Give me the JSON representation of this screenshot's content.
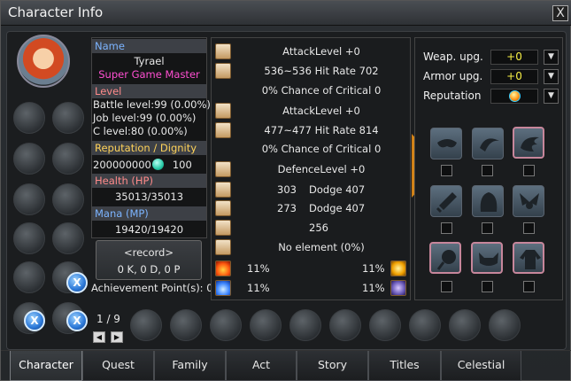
{
  "window": {
    "title": "Character Info",
    "close_label": "X"
  },
  "character": {
    "name_label": "Name",
    "name": "Tyrael",
    "rank": "Super Game Master",
    "level_label": "Level",
    "battle_level": "Battle level:99 (0.00%)",
    "job_level": "Job level:99 (0.00%)",
    "c_level": "C level:80 (0.00%)",
    "rep_label": "Reputation / Dignity",
    "reputation": "200000000",
    "dignity": "100",
    "hp_label": "Health (HP)",
    "hp": "35013/35013",
    "mp_label": "Mana (MP)",
    "mp": "19420/19420"
  },
  "record": {
    "title": "<record>",
    "kda": "0 K, 0 D, 0 P",
    "achievement": "Achievement Point(s): 0"
  },
  "stats": {
    "attack1_level": "AttackLevel +0",
    "attack1_hit": "536~536 Hit Rate 702",
    "attack1_crit": "0% Chance of Critical  0",
    "attack2_level": "AttackLevel +0",
    "attack2_hit": "477~477 Hit Rate 814",
    "attack2_crit": "0% Chance of Critical  0",
    "defence_level": "DefenceLevel +0",
    "def1_value": "303",
    "def1_dodge": "Dodge 407",
    "def2_value": "273",
    "def2_dodge": "Dodge 407",
    "def3_value": "256",
    "element": "No element (0%)",
    "fire": "11%",
    "light": "11%",
    "water": "11%",
    "dark": "11%"
  },
  "upgrades": {
    "weapon_label": "Weap. upg.",
    "weapon_value": "+0",
    "armor_label": "Armor upg.",
    "armor_value": "+0",
    "reputation_label": "Reputation",
    "dropdown_symbol": "▼"
  },
  "slots": {
    "page": "1 / 9",
    "prev": "◀",
    "next": "▶"
  },
  "tabs": [
    {
      "label": "Character"
    },
    {
      "label": "Quest"
    },
    {
      "label": "Family"
    },
    {
      "label": "Act"
    },
    {
      "label": "Story"
    },
    {
      "label": "Titles"
    },
    {
      "label": "Celestial Spire"
    }
  ],
  "colors": {
    "rank": "#ff4fd2",
    "upgrade_value": "#f8f045",
    "accent": "#f2a530"
  }
}
